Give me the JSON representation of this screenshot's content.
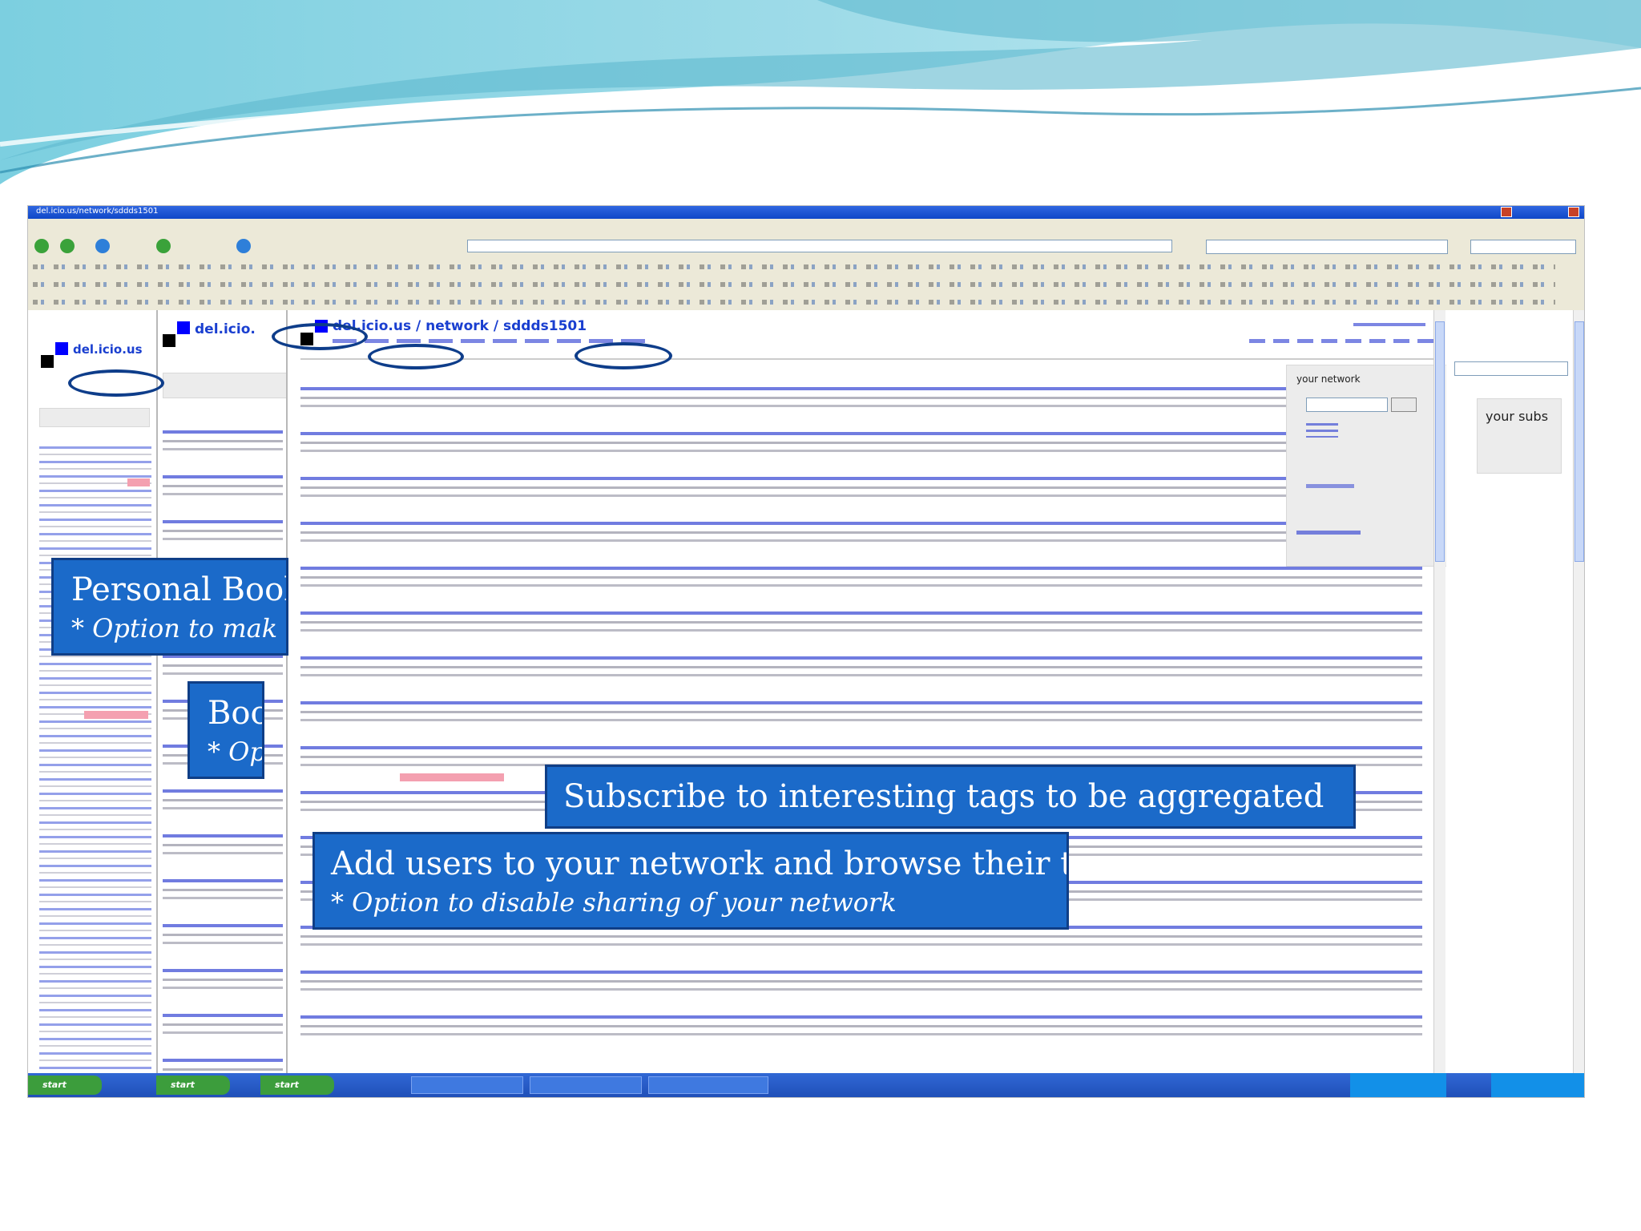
{
  "browser": {
    "title_text": "del.icio.us/network/sddds1501"
  },
  "pages": {
    "back_title": "del.icio.us",
    "middle_title": "del.icio.",
    "front_title": "del.icio.us / network / sddds1501"
  },
  "sidebar": {
    "network_label": "your network",
    "subs_label": "your subs"
  },
  "callouts": {
    "personal_heading": "Personal Book",
    "personal_sub": "* Option to mak",
    "boo_heading": "Boo",
    "boo_sub": "* Op",
    "subscribe": "Subscribe to interesting tags to be aggregated",
    "network_heading": "Add users to your network and browse their tags",
    "network_sub": "* Option to disable sharing of your network"
  },
  "taskbar": {
    "start_label": "start"
  },
  "colors": {
    "callout_fill": "#1b6ac9",
    "callout_border": "#0f3e86",
    "link_blue": "#1a3fd0",
    "xp_title": "#0f47c8"
  }
}
